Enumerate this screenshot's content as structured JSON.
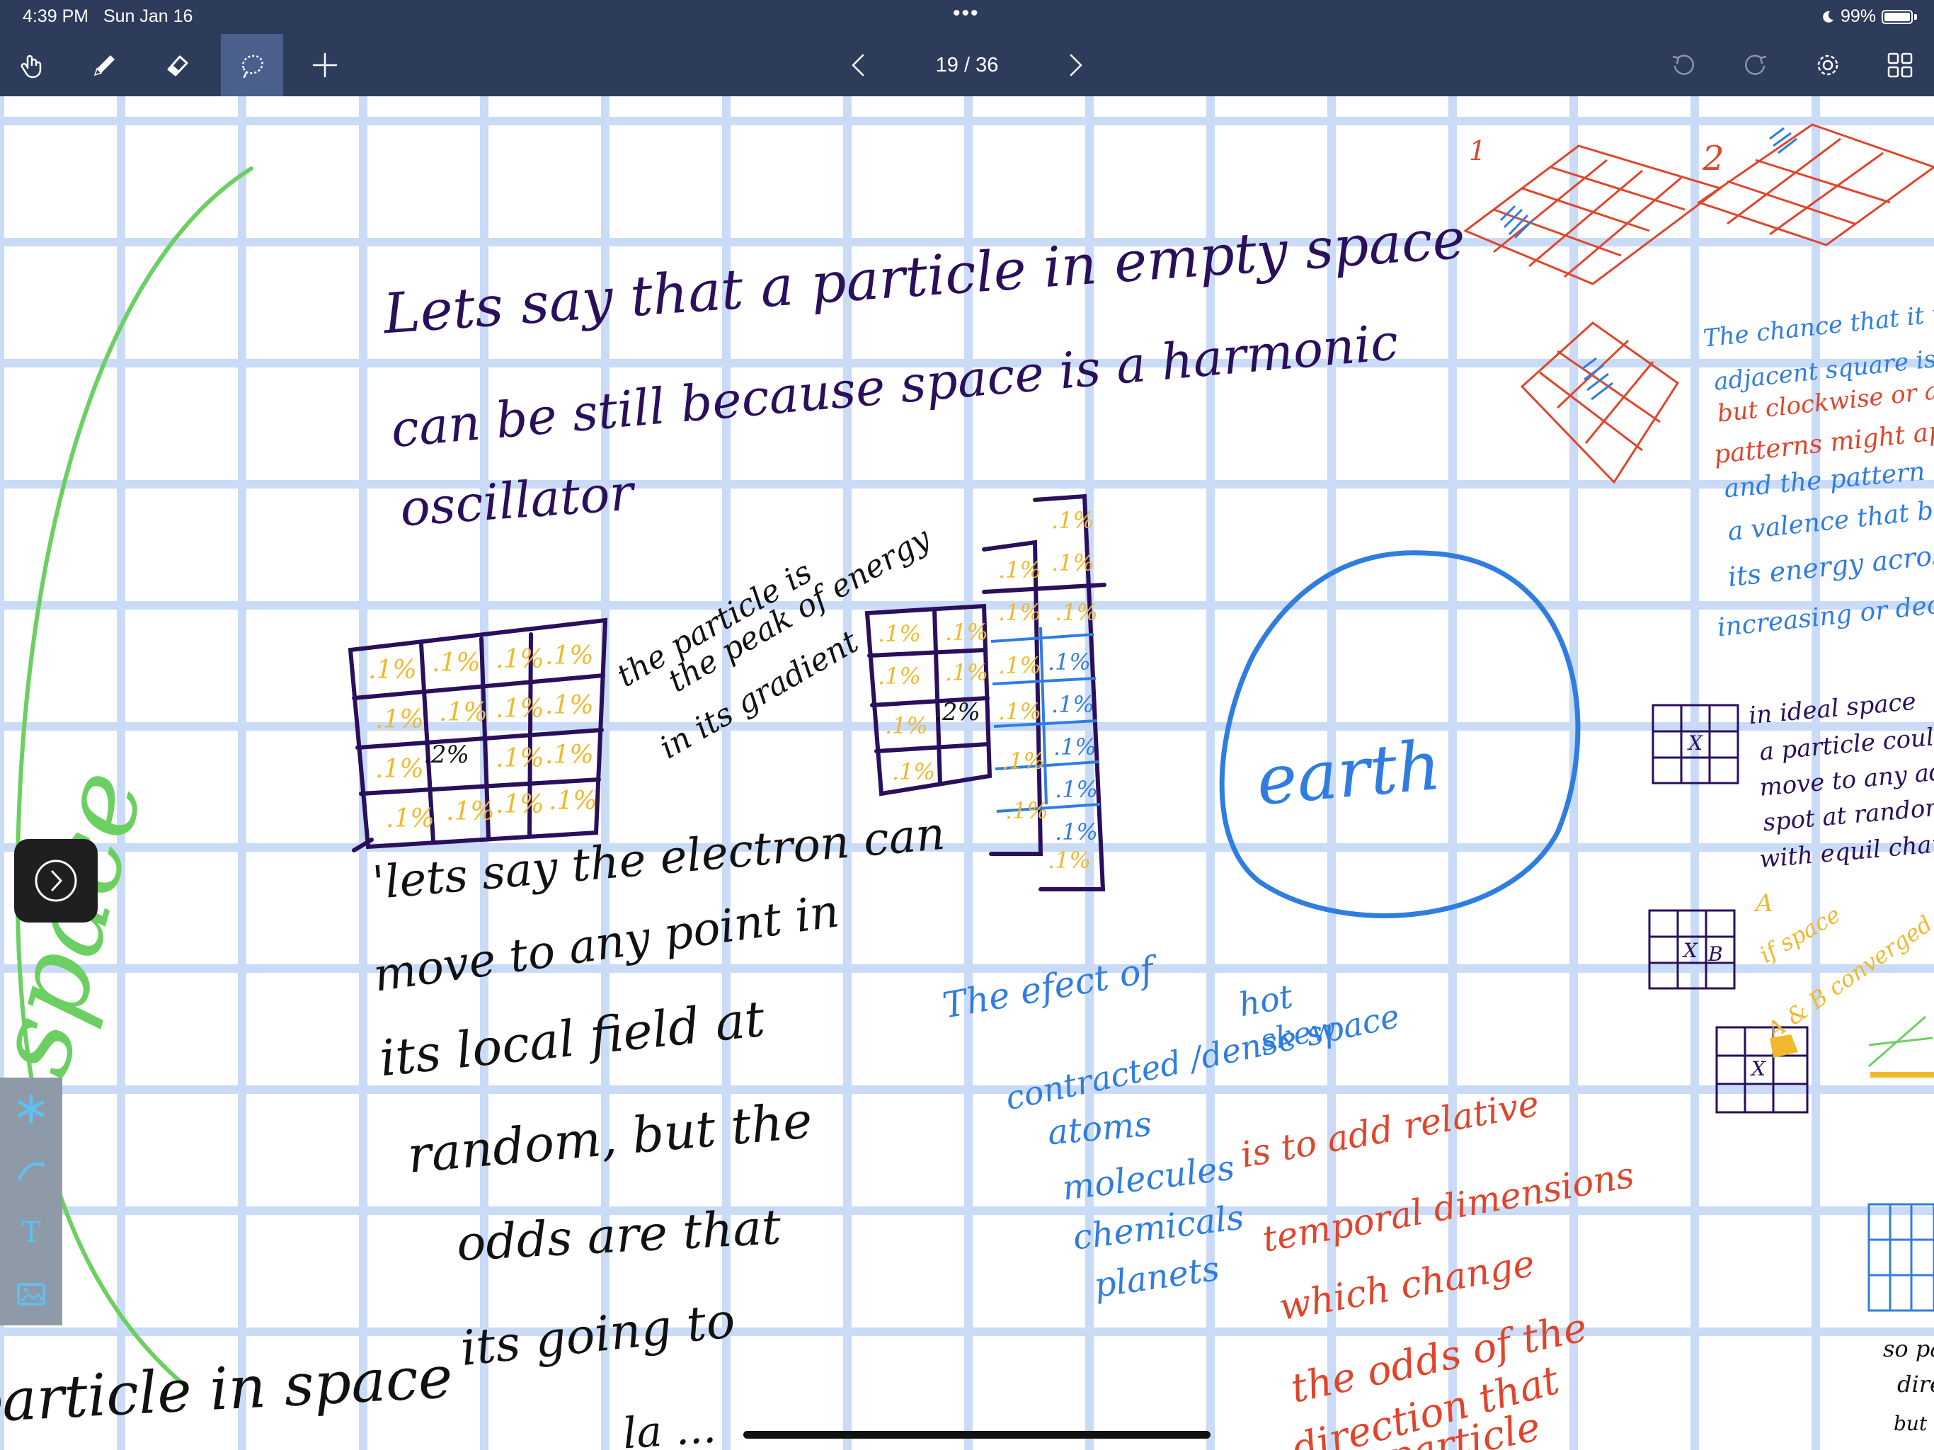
{
  "status_bar": {
    "time": "4:39 PM",
    "date": "Sun Jan 16",
    "dots": "•••",
    "battery": "99%",
    "moon_icon": "moon-icon"
  },
  "toolbar": {
    "tools": [
      {
        "name": "hand-icon",
        "active": false
      },
      {
        "name": "pencil-icon",
        "active": false
      },
      {
        "name": "eraser-icon",
        "active": false
      },
      {
        "name": "lasso-icon",
        "active": true
      },
      {
        "name": "plus-icon",
        "active": false
      }
    ],
    "page_indicator": "19 / 36",
    "right_icons": [
      "undo-icon",
      "redo-icon",
      "gear-icon",
      "grid-view-icon"
    ]
  },
  "colors": {
    "chrome": "#2e3c5c",
    "active_tool": "#4a5f8c",
    "grid": "#c9dbf7",
    "ink_purple": "#2a0f5c",
    "ink_black": "#111111",
    "ink_blue": "#2f7de0",
    "ink_red": "#e0452c",
    "ink_green": "#6ccf62",
    "ink_yellow": "#f0b92b"
  },
  "notes": {
    "main_line1": "Lets say that a particle in empty space",
    "main_line2": "can be still because space is a harmonic",
    "main_line3": "oscillator",
    "peak_note_1": "the particle is",
    "peak_note_2": "the peak of energy",
    "peak_note_3": "in its gradient",
    "grid_pct": ".1%",
    "grid_center_pct": ".2%",
    "electron_1": "'lets say the electron can",
    "electron_2": "move to any point in",
    "electron_3": "its local field at",
    "electron_4": "random, but the",
    "electron_5": "odds are that",
    "electron_6": "its going to",
    "electron_7": "la ...",
    "earth": "earth",
    "effect_1": "The efect of",
    "effect_2": "contracted /dense space",
    "effect_3": "hot",
    "effect_4": "skew",
    "list_1": "atoms",
    "list_2": "molecules",
    "list_3": "chemicals",
    "list_4": "planets",
    "red_1": "is to add relative",
    "red_2": "temporal dimensions",
    "red_3": "which change",
    "red_4": "the odds of the",
    "red_5": "direction that",
    "red_6": "the particle",
    "space_vertical": "space",
    "particle_in_space": "particle in space",
    "rc_num1": "1",
    "rc_num2": "2",
    "rc_blue_1": "The chance that it moves",
    "rc_blue_2": "adjacent square is random",
    "rc_red_1": "but clockwise or anti",
    "rc_red_2": "patterns might appear",
    "rc_blue_3": "and the pattern m",
    "rc_blue_4": "a valence that b",
    "rc_blue_5": "its energy across",
    "rc_blue_6": "increasing or decreas",
    "ideal_1": "in ideal space",
    "ideal_2": "a particle could",
    "ideal_3": "move to any adj",
    "ideal_4": "spot at random",
    "ideal_5": "with equil chance",
    "conv_1": "if space",
    "conv_2": "A & B converged",
    "label_a": "A",
    "label_b": "B",
    "label_x": "X",
    "bottom_right_1": "so pa",
    "bottom_right_2": "dire",
    "bottom_right_3": "but"
  },
  "side_toggle_icon": "chevron-right-icon",
  "tools_panel": [
    "sparkle-icon",
    "ink-curve-icon",
    "text-tool-icon",
    "image-icon"
  ],
  "tools_panel_text_label": "T"
}
